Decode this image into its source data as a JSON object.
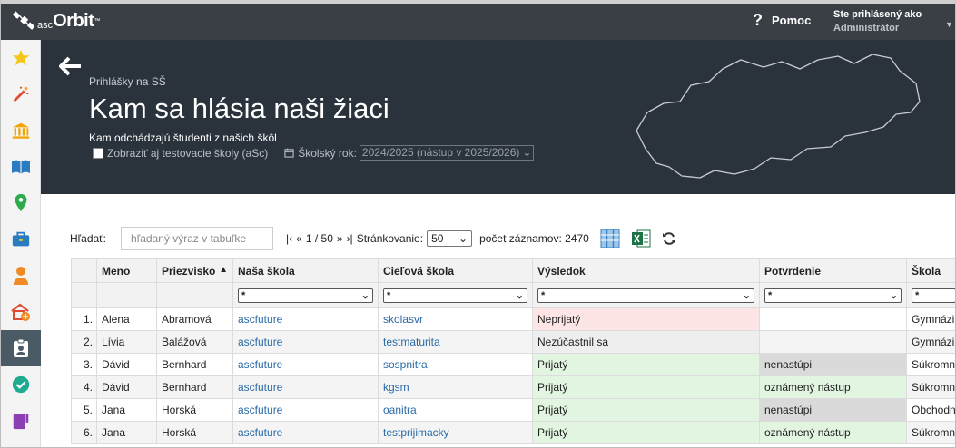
{
  "app": {
    "logo_asc": "asc",
    "logo_orbit": "Orbit",
    "logo_tm": "™"
  },
  "topbar": {
    "help_label": "Pomoc",
    "user_line1": "Ste prihlásený ako",
    "user_line2": "Administrátor"
  },
  "sidebar": {
    "items": [
      "star-icon",
      "magic-wand-icon",
      "institution-icon",
      "book-icon",
      "map-pin-icon",
      "briefcase-icon",
      "student-icon",
      "school-plus-icon",
      "clipboard-user-icon",
      "check-circle-icon",
      "fork-icon"
    ],
    "active_index": 8
  },
  "header": {
    "breadcrumb": "Prihlášky na SŠ",
    "title": "Kam sa hlásia naši žiaci",
    "subtitle": "Kam odchádzajú študenti z našich škôl",
    "show_test_schools": "Zobraziť aj testovacie školy (aSc)",
    "school_year_label": "Školský rok:",
    "school_year_value": "2024/2025 (nástup v 2025/2026)"
  },
  "toolbar": {
    "search_label": "Hľadať:",
    "search_placeholder": "hľadaný výraz v tabuľke",
    "first": "|‹",
    "prev": "«",
    "page": "1 / 50",
    "next": "»",
    "last": "›|",
    "paging_label": "Stránkovanie:",
    "paging_value": "50",
    "count_label": "počet záznamov: 2470"
  },
  "table": {
    "columns": [
      "",
      "Meno",
      "Priezvisko",
      "Naša škola",
      "Cieľová škola",
      "Výsledok",
      "Potvrdenie",
      "Škola"
    ],
    "sort_indicator": "▲",
    "filter_value": "*",
    "rows": [
      {
        "n": "1.",
        "meno": "Alena",
        "priezvisko": "Abramová",
        "nasa": "ascfuture",
        "ciel": "skolasvr",
        "vysledok": "Neprijatý",
        "vys_type": "no",
        "potvrdenie": "",
        "pot_type": "",
        "skola": "Gymnázium"
      },
      {
        "n": "2.",
        "meno": "Lívia",
        "priezvisko": "Balážová",
        "nasa": "ascfuture",
        "ciel": "testmaturita",
        "vysledok": "Nezúčastnil sa",
        "vys_type": "abs",
        "potvrdenie": "",
        "pot_type": "",
        "skola": "Gymnázium"
      },
      {
        "n": "3.",
        "meno": "Dávid",
        "priezvisko": "Bernhard",
        "nasa": "ascfuture",
        "ciel": "sospnitra",
        "vysledok": "Prijatý",
        "vys_type": "ok",
        "potvrdenie": "nenastúpi",
        "pot_type": "nen",
        "skola": "Súkromná"
      },
      {
        "n": "4.",
        "meno": "Dávid",
        "priezvisko": "Bernhard",
        "nasa": "ascfuture",
        "ciel": "kgsm",
        "vysledok": "Prijatý",
        "vys_type": "ok",
        "potvrdenie": "oznámený nástup",
        "pot_type": "ozn",
        "skola": "Súkromná"
      },
      {
        "n": "5.",
        "meno": "Jana",
        "priezvisko": "Horská",
        "nasa": "ascfuture",
        "ciel": "oanitra",
        "vysledok": "Prijatý",
        "vys_type": "ok",
        "potvrdenie": "nenastúpi",
        "pot_type": "nen",
        "skola": "Obchodná"
      },
      {
        "n": "6.",
        "meno": "Jana",
        "priezvisko": "Horská",
        "nasa": "ascfuture",
        "ciel": "testprijimacky",
        "vysledok": "Prijatý",
        "vys_type": "ok",
        "potvrdenie": "oznámený nástup",
        "pot_type": "ozn",
        "skola": "Súkromná"
      }
    ]
  },
  "colors": {
    "topbar": "#3a3f45",
    "header": "#2a323b",
    "link": "#2a6aa6",
    "rejected": "#fde5e5",
    "accepted": "#e1f5e1",
    "not_enrolling": "#dadada"
  }
}
